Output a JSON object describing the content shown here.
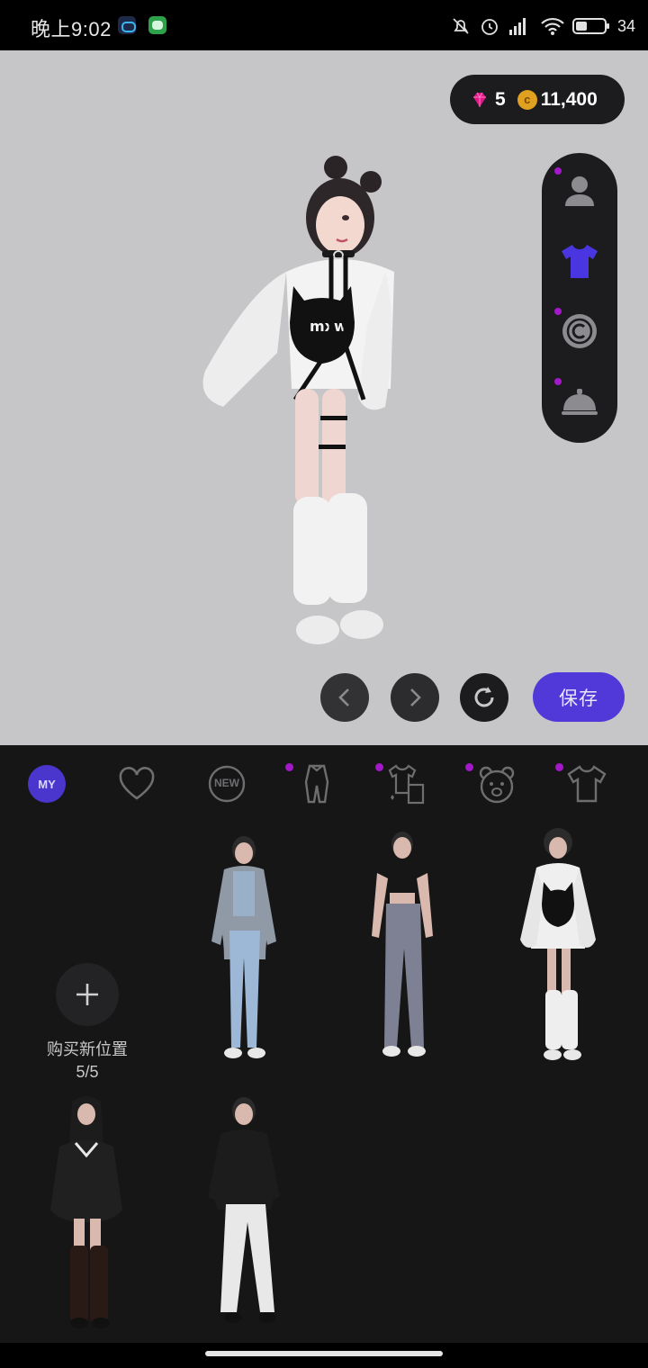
{
  "status_bar": {
    "time": "晚上9:02",
    "battery": "34"
  },
  "currency": {
    "gems": "5",
    "coins": "11,400",
    "coin_symbol": "c"
  },
  "side_panel": {
    "items": [
      {
        "icon": "person-icon",
        "dot": true
      },
      {
        "icon": "shirt-icon",
        "active": true
      },
      {
        "icon": "copyright-icon",
        "dot": true
      },
      {
        "icon": "bell-icon",
        "dot": true
      }
    ]
  },
  "controls": {
    "save_label": "保存"
  },
  "tabs": [
    {
      "label": "MY",
      "icon": "my-icon",
      "active": true
    },
    {
      "icon": "heart-icon"
    },
    {
      "label": "NEW",
      "icon": "new-icon"
    },
    {
      "icon": "jumpsuit-icon",
      "dot": true
    },
    {
      "icon": "outfit-set-icon",
      "dot": true
    },
    {
      "icon": "bear-icon",
      "dot": true
    },
    {
      "icon": "tshirt-icon",
      "dot": true
    }
  ],
  "closet": {
    "add_slot_label": "购买新位置",
    "add_slot_count": "5/5",
    "outfits": [
      {
        "name": "plaid-jacket-outfit"
      },
      {
        "name": "crop-top-jeans-outfit"
      },
      {
        "name": "cat-sweater-outfit"
      },
      {
        "name": "black-sweater-longhair-outfit"
      },
      {
        "name": "black-top-white-pants-outfit"
      }
    ]
  },
  "colors": {
    "accent": "#5138d8",
    "notification_dot": "#a318c8",
    "stage_bg": "#c6c6c8",
    "closet_bg": "#161617"
  }
}
